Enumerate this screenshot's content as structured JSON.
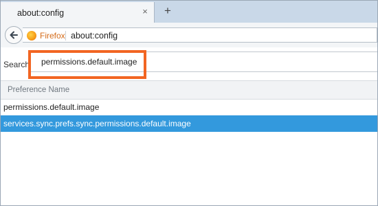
{
  "tab": {
    "title": "about:config",
    "close_glyph": "×"
  },
  "newtab_glyph": "+",
  "navbar": {
    "back_icon": "back-arrow-icon",
    "identity_label": "Firefox",
    "url": "about:config"
  },
  "search": {
    "label": "Search:",
    "value": "permissions.default.image"
  },
  "table": {
    "columns": [
      "Preference Name"
    ],
    "rows": [
      {
        "name": "permissions.default.image",
        "selected": false
      },
      {
        "name": "services.sync.prefs.sync.permissions.default.image",
        "selected": true
      }
    ]
  },
  "colors": {
    "highlight": "#f26522",
    "selection": "#3399dd",
    "identity": "#d46a17"
  }
}
